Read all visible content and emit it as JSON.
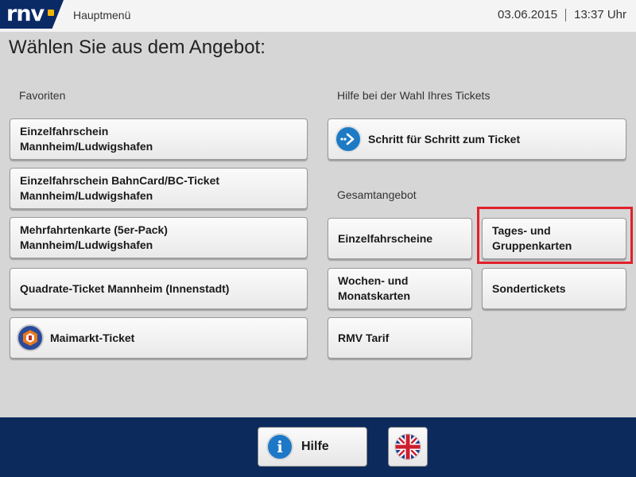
{
  "header": {
    "logo_text": "rnv",
    "menu_title": "Hauptmenü",
    "date": "03.06.2015",
    "time": "13:37 Uhr"
  },
  "heading": "Wählen Sie aus dem Angebot:",
  "favorites": {
    "label": "Favoriten",
    "items": [
      {
        "label": "Einzelfahrschein\nMannheim/Ludwigshafen"
      },
      {
        "label": "Einzelfahrschein BahnCard/BC-Ticket\nMannheim/Ludwigshafen"
      },
      {
        "label": "Mehrfahrtenkarte (5er-Pack)\nMannheim/Ludwigshafen"
      },
      {
        "label": "Quadrate-Ticket Mannheim (Innenstadt)"
      },
      {
        "label": "Maimarkt-Ticket",
        "icon": "maimarkt-logo-icon"
      }
    ]
  },
  "help_section": {
    "label": "Hilfe bei der Wahl Ihres Tickets",
    "step_button": {
      "label": "Schritt für Schritt zum Ticket",
      "icon": "arrow-right-icon"
    }
  },
  "overall": {
    "label": "Gesamtangebot",
    "items": [
      {
        "label": "Einzelfahrscheine"
      },
      {
        "label": "Tages- und\nGruppenkarten"
      },
      {
        "label": "Wochen- und\nMonatskarten"
      },
      {
        "label": "Sondertickets"
      },
      {
        "label": "RMV Tarif"
      }
    ]
  },
  "footer": {
    "help_label": "Hilfe",
    "help_icon_glyph": "i",
    "language_icon": "uk-flag-icon"
  },
  "colors": {
    "brand_navy": "#0c2a5c",
    "highlight": "#e0202a",
    "accent_blue": "#1e78c8"
  }
}
